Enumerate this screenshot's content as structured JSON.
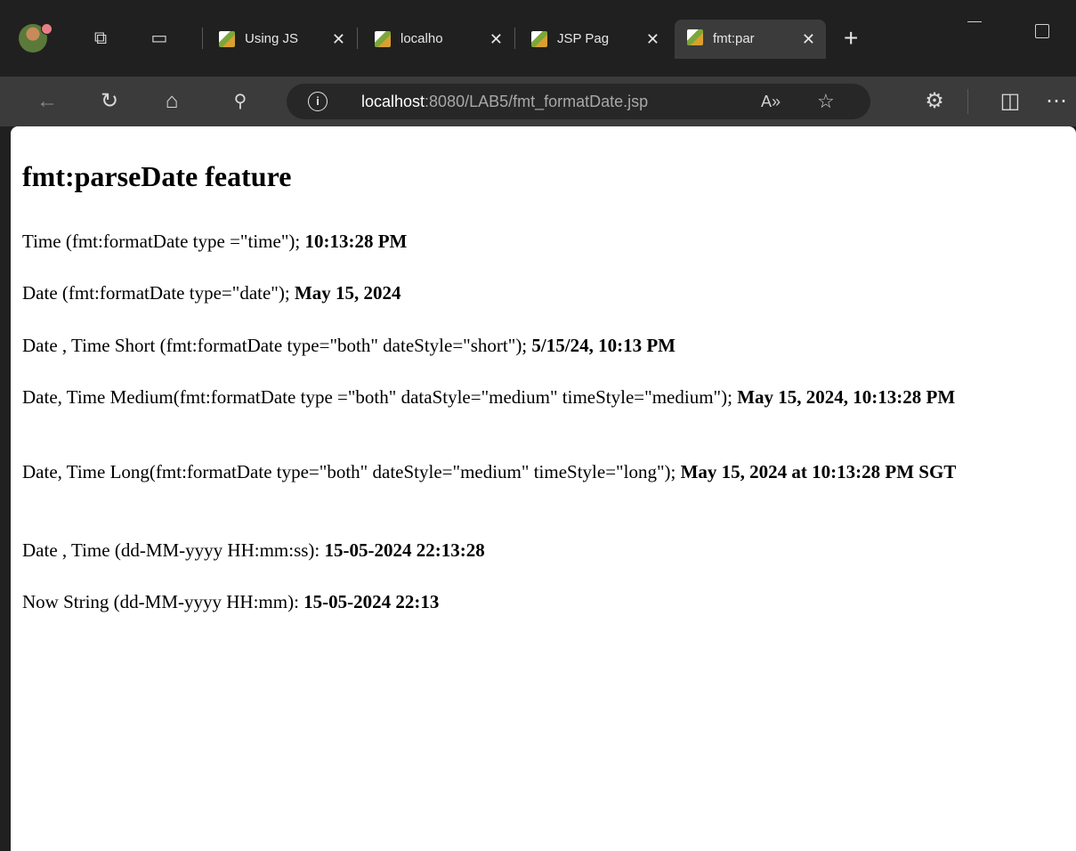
{
  "browser": {
    "tabs": [
      {
        "title": "Using JS",
        "active": false
      },
      {
        "title": "localho",
        "active": false
      },
      {
        "title": "JSP Pag",
        "active": false
      },
      {
        "title": "fmt:par",
        "active": true
      }
    ],
    "new_tab_label": "+",
    "address": {
      "host": "localhost",
      "rest": ":8080/LAB5/fmt_formatDate.jsp"
    }
  },
  "page": {
    "heading": "fmt:parseDate feature",
    "lines": [
      {
        "label": "Time (fmt:formatDate type =\"time\"); ",
        "value": "10:13:28 PM"
      },
      {
        "label": "Date (fmt:formatDate type=\"date\"); ",
        "value": "May 15, 2024"
      },
      {
        "label": "Date , Time Short (fmt:formatDate type=\"both\" dateStyle=\"short\"); ",
        "value": "5/15/24, 10:13 PM"
      },
      {
        "label": "Date, Time Medium(fmt:formatDate type =\"both\" dataStyle=\"medium\" timeStyle=\"medium\"); ",
        "value": "May 15, 2024, 10:13:28 PM"
      },
      {
        "label": "Date, Time Long(fmt:formatDate type=\"both\" dateStyle=\"medium\" timeStyle=\"long\"); ",
        "value": "May 15, 2024 at 10:13:28 PM SGT"
      },
      {
        "label": "Date , Time (dd-MM-yyyy HH:mm:ss): ",
        "value": "15-05-2024 22:13:28"
      },
      {
        "label": "Now String (dd-MM-yyyy HH:mm): ",
        "value": "15-05-2024 22:13"
      }
    ]
  }
}
